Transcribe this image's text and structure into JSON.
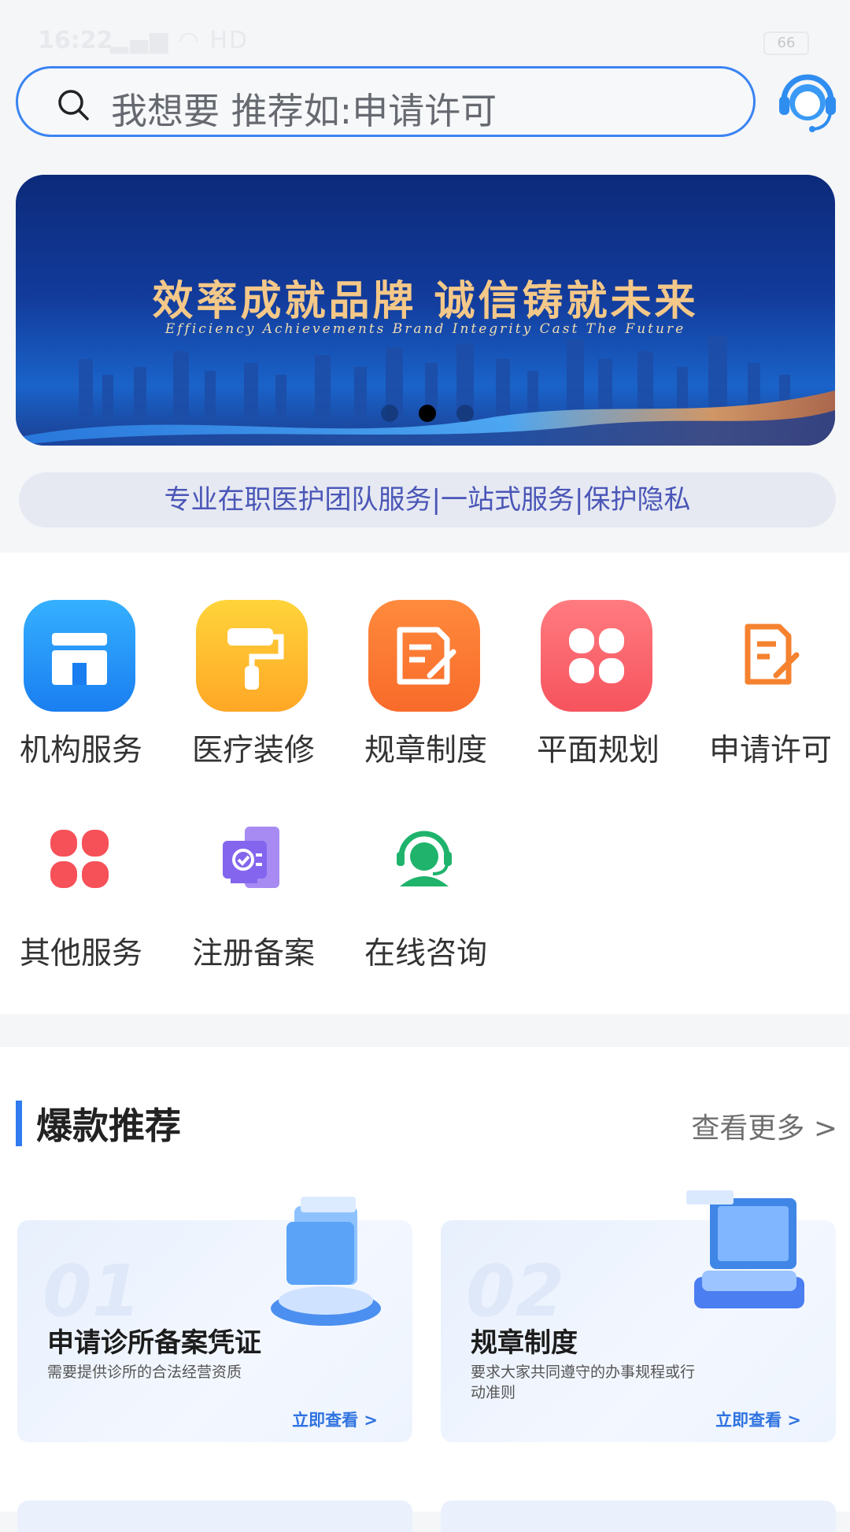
{
  "status_bar": {
    "time": "16:22",
    "network": "HD",
    "battery": "66"
  },
  "search": {
    "placeholder": "我想要 推荐如:申请许可"
  },
  "banner": {
    "title": "效率成就品牌 诚信铸就未来",
    "subtitle": "Efficiency Achievements Brand Integrity Cast The Future",
    "active_dot": 2,
    "dot_count": 3
  },
  "tagline": "专业在职医护团队服务|一站式服务|保护隐私",
  "services": [
    {
      "label": "机构服务",
      "icon": "storefront-icon"
    },
    {
      "label": "医疗装修",
      "icon": "paint-roller-icon"
    },
    {
      "label": "规章制度",
      "icon": "document-edit-icon"
    },
    {
      "label": "平面规划",
      "icon": "four-petal-icon"
    },
    {
      "label": "申请许可",
      "icon": "document-edit-outline-icon"
    },
    {
      "label": "其他服务",
      "icon": "four-petal-red-icon"
    },
    {
      "label": "注册备案",
      "icon": "registration-icon"
    },
    {
      "label": "在线咨询",
      "icon": "headset-agent-icon"
    }
  ],
  "recommend": {
    "title": "爆款推荐",
    "more": "查看更多 >",
    "cards": [
      {
        "num": "01",
        "title": "申请诊所备案凭证",
        "desc": "需要提供诊所的合法经营资质",
        "link": "立即查看 >"
      },
      {
        "num": "02",
        "title": "规章制度",
        "desc": "要求大家共同遵守的办事规程或行动准则",
        "link": "立即查看 >"
      }
    ]
  },
  "colors": {
    "accent": "#3a84f2",
    "tagline_text": "#4a56b7",
    "link": "#2f73e0"
  }
}
